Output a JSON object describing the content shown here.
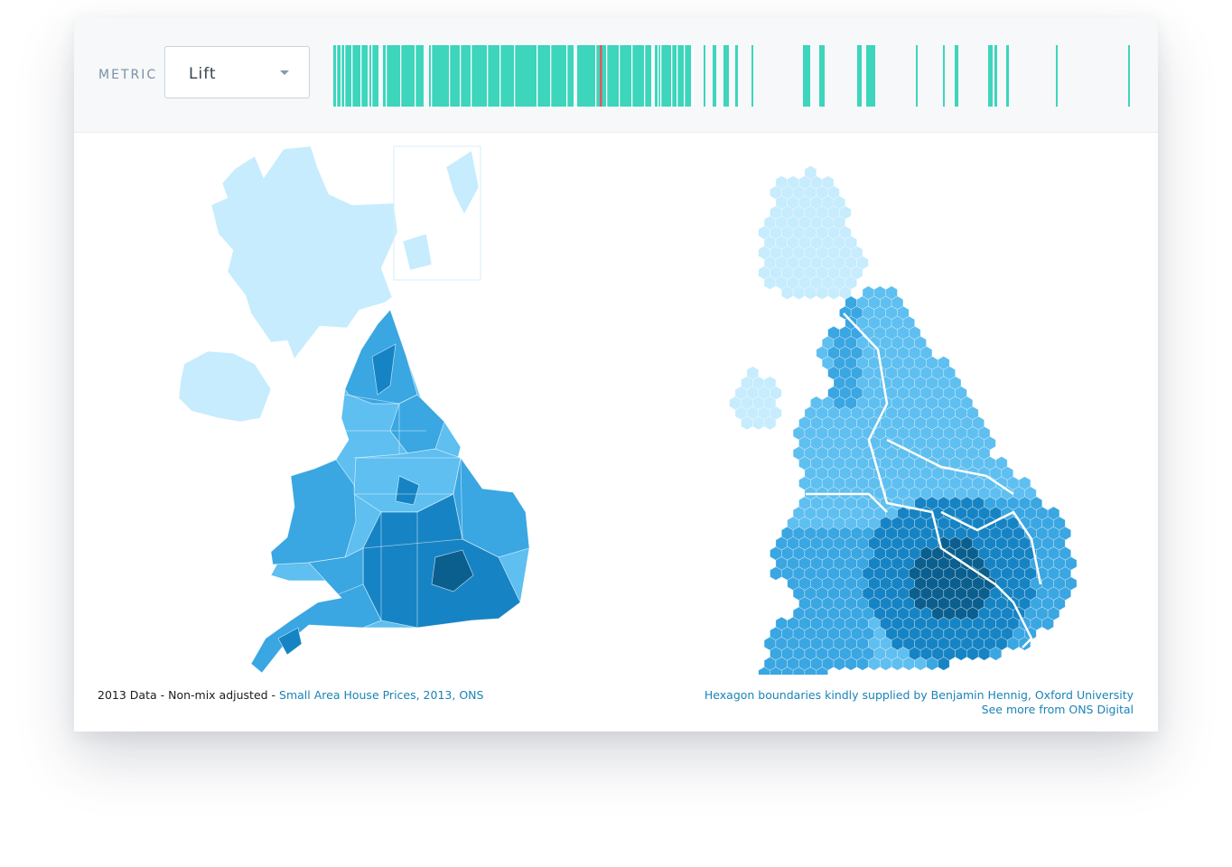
{
  "toolbar": {
    "metric_label": "METRIC",
    "metric_selected": "Lift",
    "options_visible": [
      "Lift"
    ]
  },
  "distribution_strip": {
    "bar_color": "#3dd5bc",
    "marker_color": "#e8545c"
  },
  "choropleth_colors": {
    "scotland": "#c6ecfd",
    "light": "#5ebff0",
    "mid": "#3aa6e2",
    "dark": "#1684c4",
    "darkest": "#0a5f8f"
  },
  "captions": {
    "left_prefix": "2013 Data - Non-mix adjusted - ",
    "left_link": "Small Area House Prices, 2013, ONS",
    "right_link_1": "Hexagon boundaries kindly supplied by Benjamin Hennig, Oxford University",
    "right_link_2": "See more from ONS Digital"
  }
}
